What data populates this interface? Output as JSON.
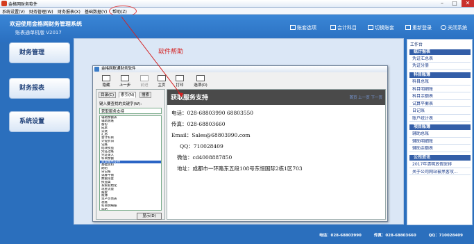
{
  "window": {
    "title": "金格网财务软件",
    "minimize": "–",
    "maximize": "□",
    "close": "✕"
  },
  "menubar": [
    "系统设置(V)",
    "财务管理(W)",
    "财务报表(X)",
    "基础数据(Y)",
    "帮助(Z)"
  ],
  "header": {
    "welcome": "欢迎使用金格网财务管理系统",
    "account": "账表通单机版 V2017",
    "buttons": [
      "账套选项",
      "会计科目",
      "切换账套",
      "重新登录",
      "关闭系统"
    ]
  },
  "nav": [
    "财务管理",
    "财务报表",
    "系统设置"
  ],
  "annotation": "软件帮助",
  "workbench": {
    "title": "工作台",
    "sections": [
      {
        "name": "统计报表",
        "items": [
          "凭证汇总表",
          "凭证分册"
        ]
      },
      {
        "name": "科目账簿",
        "items": [
          "科目总账",
          "科目明细账",
          "科目余额表",
          "试算平衡表",
          "日记账",
          "账户统计表"
        ]
      },
      {
        "name": "项目账簿",
        "items": [
          "辅助总账",
          "辅助明细账",
          "辅助余额表"
        ]
      },
      {
        "name": "公司资讯",
        "items": [
          "2017年清明放假安排",
          "关于公司网站被黑客攻..."
        ]
      }
    ]
  },
  "help_window": {
    "title": "金格网账通财务软件",
    "toolbar": [
      "隐藏",
      "上一步",
      "前进",
      "主页",
      "打印",
      "选项(O)"
    ],
    "tabs": [
      "目录(C)",
      "索引(N)",
      "搜索"
    ],
    "keyword_label": "键入要查找的关键字(W):",
    "keyword_value": "获取服务支持",
    "keywords": [
      "辅助余额表",
      "辅助总账",
      "备份",
      "成本",
      "公式",
      "汇总",
      "会计科目",
      "计提折旧",
      "记账",
      "结转损益",
      "凭证过账",
      "凭证录入",
      "科目余额",
      "获取服务支持",
      "基础资料",
      "期初",
      "日记账",
      "试算平衡",
      "数据恢复",
      "损益类",
      "系统初始化",
      "现金流量",
      "账套",
      "账簿",
      "资产负债表",
      "总账",
      "科目明细账",
      "年结"
    ],
    "selected_keyword": "获取服务支持",
    "show_button": "显示(D)",
    "page_title": "获取服务支持",
    "page_nav": "首页 上一页 下一页",
    "contacts": [
      "电话：028-68803990  68803550",
      "传真：028-68803660",
      "Email：Sales@68803990.com",
      "QQ：710028409",
      "微信：cd4008887850",
      "地址：成都市一环路东五段108号东恒国际2栋1区703"
    ]
  },
  "footer": {
    "phone": "电话：028-68803990",
    "fax": "传真：028-68803660",
    "qq": "QQ：710028409"
  }
}
